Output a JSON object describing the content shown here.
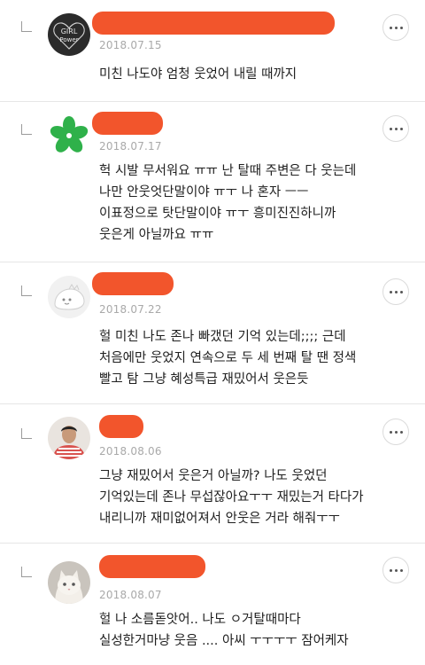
{
  "comments": [
    {
      "avatar": "girl-power-avatar",
      "date": "2018.07.15",
      "lines": [
        "미친 나도야 엄청 웃었어 내릴 때까지"
      ]
    },
    {
      "avatar": "green-star-avatar",
      "date": "2018.07.17",
      "lines": [
        "헉 시발 무서워요 ㅠㅠ 난 탈때 주변은 다 웃는데",
        "나만 안웃엇단말이야 ㅠㅜ 나 혼자 ㅡㅡ",
        "이표정으로 탓단말이야 ㅠㅜ 흥미진진하니까",
        "웃은게 아닐까요 ㅠㅠ"
      ]
    },
    {
      "avatar": "white-creature-avatar",
      "date": "2018.07.22",
      "lines": [
        "헐 미친 나도 존나 빠갰던 기억 있는데;;;; 근데",
        "처음에만 웃었지 연속으로 두 세 번째 탈 땐 정색",
        "빨고 탐 그냥 혜성특급 재밌어서 웃은듯"
      ]
    },
    {
      "avatar": "person-photo-avatar",
      "date": "2018.08.06",
      "lines": [
        "그냥 재밌어서 웃은거 아닐까? 나도 웃었던",
        "기억있는데 존나 무섭잖아요ㅜㅜ 재밌는거 타다가",
        "내리니까 재미없어져서 안웃은 거라 해줘ㅜㅜ"
      ]
    },
    {
      "avatar": "cat-photo-avatar",
      "date": "2018.08.07",
      "lines": [
        "헐 나 소름돋앗어.. 나도 ㅇ거탈때마다",
        "실성한거마냥 웃음 .... 아씨 ㅜㅜㅜㅜ 잠어케자"
      ]
    }
  ],
  "colors": {
    "redaction": "#f2552c",
    "date": "#a9a9a9",
    "divider": "#e6e6e6"
  }
}
